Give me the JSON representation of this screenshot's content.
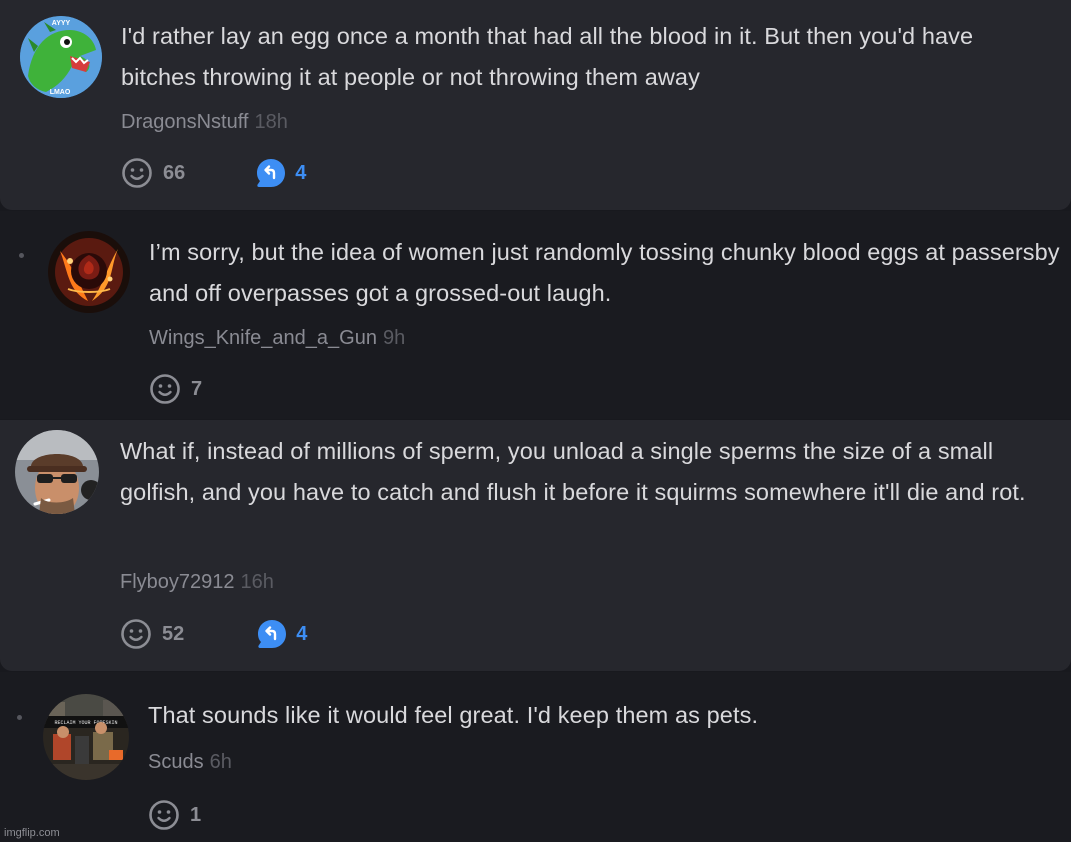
{
  "comments": [
    {
      "text": "I'd rather lay an egg once a month that had all the blood in it. But then you'd have bitches throwing it at people or not throwing them away",
      "username": "DragonsNstuff",
      "time": "18h",
      "reactions": "66",
      "replies": "4",
      "avatar_text_top": "AYYY",
      "avatar_text_bottom": "LMAO"
    },
    {
      "text": "I’m sorry, but the idea of women just randomly tossing chunky blood eggs at passersby and off overpasses got a grossed-out laugh.",
      "username": "Wings_Knife_and_a_Gun",
      "time": "9h",
      "reactions": "7"
    },
    {
      "text": "What if, instead of millions of sperm, you unload a single sperms the size of a small golfish, and you have to catch and flush it before it squirms somewhere it'll die and rot.",
      "username": "Flyboy72912",
      "time": "16h",
      "reactions": "52",
      "replies": "4"
    },
    {
      "text": "That sounds like it would feel great. I'd keep them as pets.",
      "username": "Scuds",
      "time": "6h",
      "reactions": "1",
      "avatar_text": "RECLAIM YOUR FORESKIN"
    }
  ],
  "watermark": "imgflip.com",
  "icons": {
    "reaction": "smiley-face-icon",
    "reply": "reply-arrow-bubble-icon"
  },
  "colors": {
    "top_comment_bg": "#26272d",
    "reply_bg": "#1a1b20",
    "reply_accent": "#3d8ef4"
  }
}
